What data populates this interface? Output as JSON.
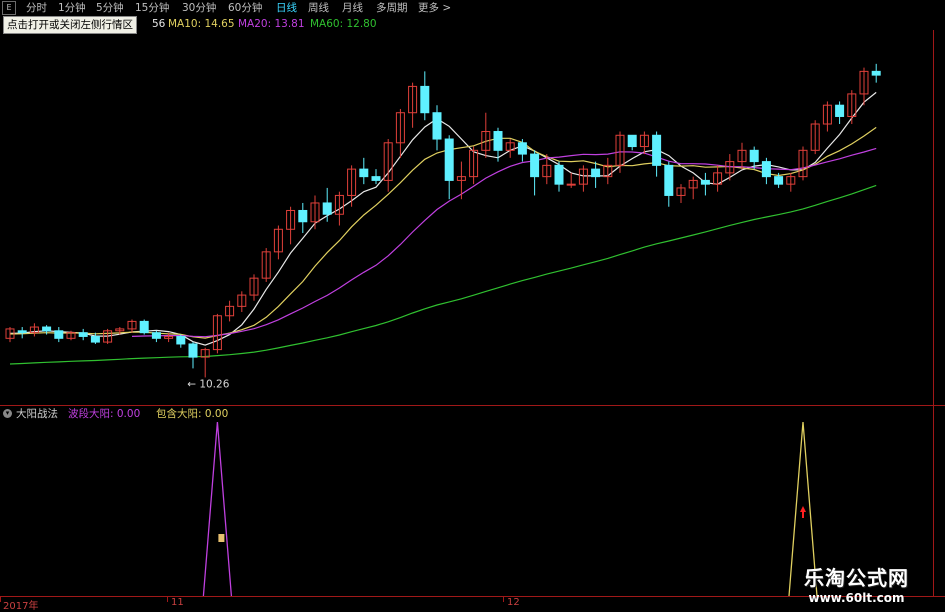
{
  "toolbar": {
    "menu_icon": "E",
    "periods": [
      "分时",
      "1分钟",
      "5分钟",
      "15分钟",
      "30分钟",
      "60分钟",
      "日线",
      "周线",
      "月线",
      "多周期",
      "更多 >"
    ],
    "active_period": "日线"
  },
  "tooltip": {
    "text": "点击打开或关闭左侧行情区"
  },
  "ma_legend": {
    "ma5_tail": "56",
    "ma10": "MA10: 14.65",
    "ma20": "MA20: 13.81",
    "ma60": "MA60: 12.80"
  },
  "price_annotation": "← 10.26",
  "indicator": {
    "name": "大阳战法",
    "item1": "波段大阳: 0.00",
    "item2": "包含大阳: 0.00"
  },
  "dates": [
    "2017年",
    "11",
    "12"
  ],
  "watermark": {
    "title": "乐淘公式网",
    "url": "www.60lt.com"
  },
  "colors": {
    "up": "#e0403a",
    "down": "#5ff0ff",
    "ma5": "#e8e8e8",
    "ma10": "#e0d060",
    "ma20": "#c040e0",
    "ma60": "#30c030",
    "axis": "#a01818",
    "spike1": "#c040e0",
    "spike2": "#e0d060"
  },
  "chart_data": {
    "type": "candlestick",
    "price_range": [
      9.5,
      19.5
    ],
    "candles": [
      [
        11.3,
        11.55,
        11.2,
        11.6
      ],
      [
        11.5,
        11.45,
        11.3,
        11.6
      ],
      [
        11.45,
        11.6,
        11.35,
        11.7
      ],
      [
        11.6,
        11.5,
        11.4,
        11.65
      ],
      [
        11.5,
        11.3,
        11.2,
        11.6
      ],
      [
        11.3,
        11.45,
        11.25,
        11.5
      ],
      [
        11.45,
        11.35,
        11.25,
        11.55
      ],
      [
        11.35,
        11.2,
        11.15,
        11.45
      ],
      [
        11.2,
        11.5,
        11.15,
        11.55
      ],
      [
        11.5,
        11.55,
        11.4,
        11.6
      ],
      [
        11.55,
        11.75,
        11.45,
        11.8
      ],
      [
        11.75,
        11.45,
        11.4,
        11.8
      ],
      [
        11.45,
        11.3,
        11.2,
        11.5
      ],
      [
        11.3,
        11.35,
        11.2,
        11.45
      ],
      [
        11.35,
        11.15,
        11.05,
        11.4
      ],
      [
        11.15,
        10.8,
        10.5,
        11.2
      ],
      [
        10.8,
        11.0,
        10.26,
        11.05
      ],
      [
        11.0,
        11.9,
        10.9,
        11.95
      ],
      [
        11.9,
        12.15,
        11.75,
        12.3
      ],
      [
        12.15,
        12.45,
        12.0,
        12.55
      ],
      [
        12.45,
        12.9,
        12.3,
        13.0
      ],
      [
        12.9,
        13.6,
        12.8,
        13.7
      ],
      [
        13.6,
        14.2,
        13.4,
        14.3
      ],
      [
        14.2,
        14.7,
        13.8,
        14.8
      ],
      [
        14.7,
        14.4,
        14.1,
        14.9
      ],
      [
        14.4,
        14.9,
        14.2,
        15.1
      ],
      [
        14.9,
        14.6,
        14.4,
        15.3
      ],
      [
        14.6,
        15.1,
        14.3,
        15.2
      ],
      [
        15.1,
        15.8,
        14.8,
        15.9
      ],
      [
        15.8,
        15.6,
        15.4,
        16.1
      ],
      [
        15.6,
        15.5,
        15.4,
        15.8
      ],
      [
        15.5,
        16.5,
        15.2,
        16.6
      ],
      [
        16.5,
        17.3,
        16.1,
        17.4
      ],
      [
        17.3,
        18.0,
        16.9,
        18.1
      ],
      [
        18.0,
        17.3,
        17.1,
        18.4
      ],
      [
        17.3,
        16.6,
        16.3,
        17.5
      ],
      [
        16.6,
        15.5,
        15.0,
        16.7
      ],
      [
        15.5,
        15.6,
        15.0,
        16.0
      ],
      [
        15.6,
        16.3,
        15.4,
        16.4
      ],
      [
        16.3,
        16.8,
        16.1,
        17.3
      ],
      [
        16.8,
        16.3,
        16.0,
        16.9
      ],
      [
        16.3,
        16.5,
        16.1,
        16.6
      ],
      [
        16.5,
        16.2,
        16.0,
        16.6
      ],
      [
        16.2,
        15.6,
        15.1,
        16.3
      ],
      [
        15.6,
        15.9,
        15.4,
        16.2
      ],
      [
        15.9,
        15.4,
        15.2,
        16.0
      ],
      [
        15.4,
        15.4,
        15.3,
        15.7
      ],
      [
        15.4,
        15.8,
        15.2,
        15.9
      ],
      [
        15.8,
        15.6,
        15.3,
        16.0
      ],
      [
        15.6,
        15.9,
        15.4,
        16.1
      ],
      [
        15.9,
        16.7,
        15.7,
        16.8
      ],
      [
        16.7,
        16.4,
        16.3,
        16.6
      ],
      [
        16.4,
        16.7,
        16.2,
        16.8
      ],
      [
        16.7,
        15.9,
        15.6,
        16.8
      ],
      [
        15.9,
        15.1,
        14.8,
        16.0
      ],
      [
        15.1,
        15.3,
        14.9,
        15.4
      ],
      [
        15.3,
        15.5,
        15.0,
        15.6
      ],
      [
        15.5,
        15.4,
        15.1,
        15.7
      ],
      [
        15.4,
        15.7,
        15.2,
        15.9
      ],
      [
        15.7,
        16.0,
        15.5,
        16.2
      ],
      [
        16.0,
        16.3,
        15.8,
        16.5
      ],
      [
        16.3,
        16.0,
        15.8,
        16.4
      ],
      [
        16.0,
        15.6,
        15.4,
        16.1
      ],
      [
        15.6,
        15.4,
        15.3,
        15.7
      ],
      [
        15.4,
        15.6,
        15.2,
        15.7
      ],
      [
        15.6,
        16.3,
        15.5,
        16.4
      ],
      [
        16.3,
        17.0,
        16.2,
        17.1
      ],
      [
        17.0,
        17.5,
        16.8,
        17.6
      ],
      [
        17.5,
        17.2,
        17.0,
        17.6
      ],
      [
        17.2,
        17.8,
        17.0,
        17.9
      ],
      [
        17.8,
        18.4,
        17.5,
        18.5
      ],
      [
        18.4,
        18.3,
        18.1,
        18.6
      ]
    ],
    "ma_series": [
      "MA5",
      "MA10",
      "MA20",
      "MA60"
    ],
    "ma_legend": {
      "MA10": 14.65,
      "MA20": 13.81,
      "MA60": 12.8
    },
    "annotation": {
      "label": "10.26",
      "value": 10.26
    },
    "indicator": {
      "name": "大阳战法",
      "series": [
        {
          "name": "波段大阳",
          "value": 0.0,
          "spike_at_candle": 17
        },
        {
          "name": "包含大阳",
          "value": 0.0,
          "spike_at_candle": 65
        }
      ]
    },
    "x_labels": [
      "2017年",
      "11",
      "12"
    ]
  }
}
